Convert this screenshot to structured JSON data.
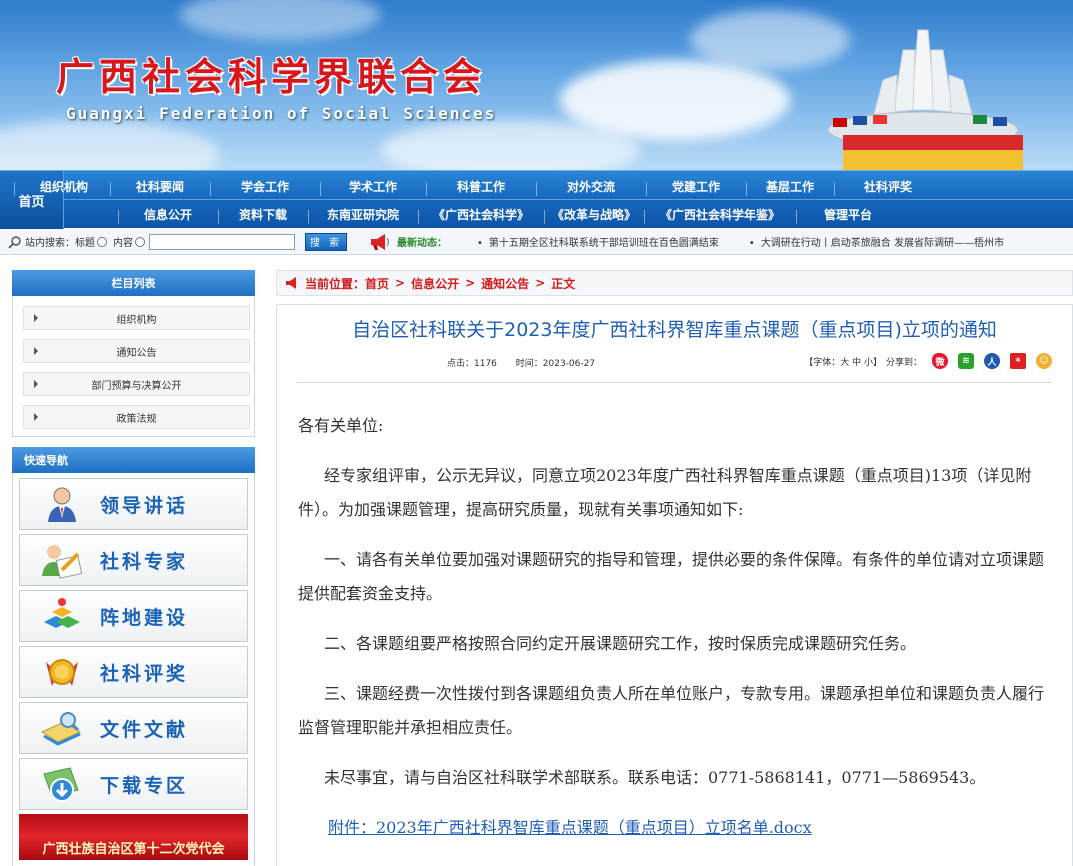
{
  "banner": {
    "title": "广西社会科学界联合会",
    "subtitle": "Guangxi Federation of Social Sciences"
  },
  "nav": {
    "home": "首页",
    "row1": [
      "组织机构",
      "社科要闻",
      "学会工作",
      "学术工作",
      "科普工作",
      "对外交流",
      "党建工作",
      "基层工作",
      "社科评奖"
    ],
    "row2": [
      "信息公开",
      "资料下载",
      "东南亚研究院",
      "《广西社会科学》",
      "《改革与战略》",
      "《广西社会科学年鉴》",
      "管理平台"
    ]
  },
  "search": {
    "label": "站内搜索：",
    "opt_title": "标题",
    "opt_content": "内容",
    "input_value": "",
    "button": "搜 索",
    "news_label": "最新动态：",
    "news": [
      "第十五期全区社科联系统干部培训班在百色圆满结束",
      "大调研在行动丨启动茶旅融合 发展省际调研——梧州市"
    ]
  },
  "sidebar": {
    "columns_title": "栏目列表",
    "columns": [
      "组织机构",
      "通知公告",
      "部门预算与决算公开",
      "政策法规"
    ],
    "quick_title": "快速导航",
    "quick": [
      "领导讲话",
      "社科专家",
      "阵地建设",
      "社科评奖",
      "文件文献",
      "下载专区"
    ],
    "party_banner": "广西壮族自治区第十二次党代会"
  },
  "breadcrumb": {
    "current": "当前位置：",
    "items": [
      "首页",
      "信息公开",
      "通知公告",
      "正文"
    ]
  },
  "article": {
    "title": "自治区社科联关于2023年度广西社科界智库重点课题（重点项目)立项的通知",
    "clicks": "点击：1176",
    "date": "时间：2023-06-27",
    "font_ctrl": "【字体：大 中 小】",
    "share_label": "分享到：",
    "greeting": "各有关单位:",
    "paragraphs": [
      "经专家组评审，公示无异议，同意立项2023年度广西社科界智库重点课题（重点项目)13项（详见附件）。为加强课题管理，提高研究质量，现就有关事项通知如下:",
      "一、请各有关单位要加强对课题研究的指导和管理，提供必要的条件保障。有条件的单位请对立项课题提供配套资金支持。",
      "二、各课题组要严格按照合同约定开展课题研究工作，按时保质完成课题研究任务。",
      "三、课题经费一次性拨付到各课题组负责人所在单位账户，专款专用。课题承担单位和课题负责人履行监督管理职能并承担相应责任。",
      "未尽事宜，请与自治区社科联学术部联系。联系电话：0771-5868141，0771—5869543。"
    ],
    "attachment": "附件：2023年广西社科界智库重点课题（重点项目）立项名单.docx"
  }
}
